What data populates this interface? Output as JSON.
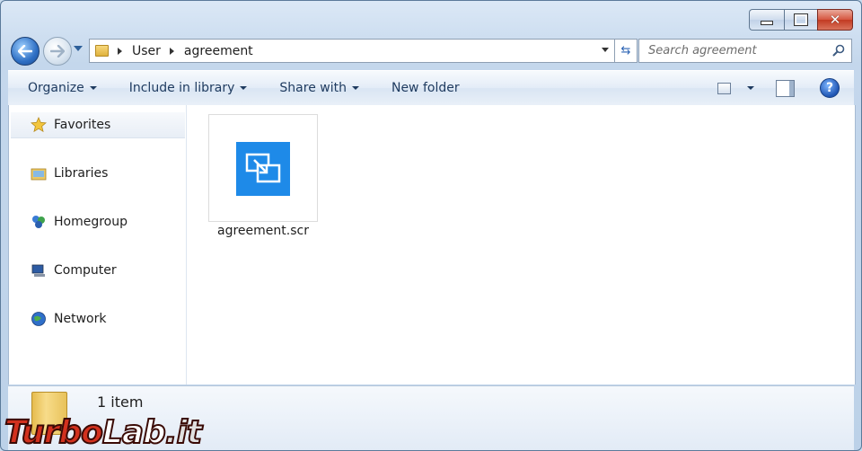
{
  "window": {
    "caption_buttons": {
      "minimize": "minimize-icon",
      "maximize": "maximize-icon",
      "close": "close-icon"
    }
  },
  "address": {
    "crumbs": [
      "User",
      "agreement"
    ]
  },
  "search": {
    "placeholder": "Search agreement"
  },
  "toolbar": {
    "organize": "Organize",
    "include_in_library": "Include in library",
    "share_with": "Share with",
    "new_folder": "New folder"
  },
  "nav": {
    "items": [
      {
        "label": "Favorites",
        "icon": "star-icon"
      },
      {
        "label": "Libraries",
        "icon": "libraries-icon"
      },
      {
        "label": "Homegroup",
        "icon": "homegroup-icon"
      },
      {
        "label": "Computer",
        "icon": "computer-icon"
      },
      {
        "label": "Network",
        "icon": "network-icon"
      }
    ]
  },
  "files": [
    {
      "name": "agreement.scr",
      "icon": "screensaver-file-icon"
    }
  ],
  "status": {
    "count": "1 item"
  },
  "watermark": {
    "part1": "Turbo",
    "part2": "Lab",
    "part3": ".it"
  },
  "colors": {
    "accent": "#1e8ae8",
    "window_frame": "#c4d7ec",
    "close_button": "#c23a22"
  }
}
